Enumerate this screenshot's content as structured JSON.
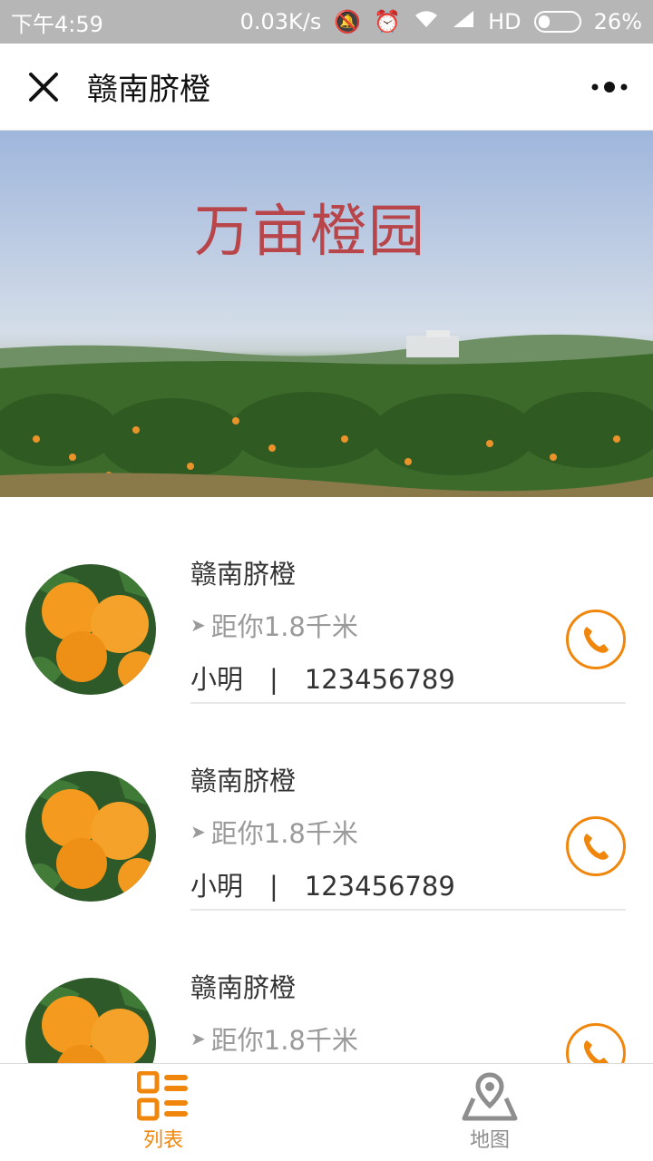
{
  "status_bar": {
    "time": "下午4:59",
    "network_speed": "0.03K/s",
    "signal": "HD",
    "battery": "26%"
  },
  "header": {
    "title": "赣南脐橙",
    "close_icon": "close-icon",
    "more_icon": "more-icon"
  },
  "banner": {
    "title": "万亩橙园"
  },
  "list": {
    "items": [
      {
        "name": "赣南脐橙",
        "distance": "距你1.8千米",
        "contact": "小明　|　123456789"
      },
      {
        "name": "赣南脐橙",
        "distance": "距你1.8千米",
        "contact": "小明　|　123456789"
      },
      {
        "name": "赣南脐橙",
        "distance": "距你1.8千米",
        "contact": ""
      }
    ]
  },
  "tabbar": {
    "tabs": [
      {
        "label": "列表",
        "icon": "list-icon",
        "active": true
      },
      {
        "label": "地图",
        "icon": "map-icon",
        "active": false
      }
    ]
  },
  "colors": {
    "accent": "#f0870c",
    "banner_title": "#b8454a"
  }
}
